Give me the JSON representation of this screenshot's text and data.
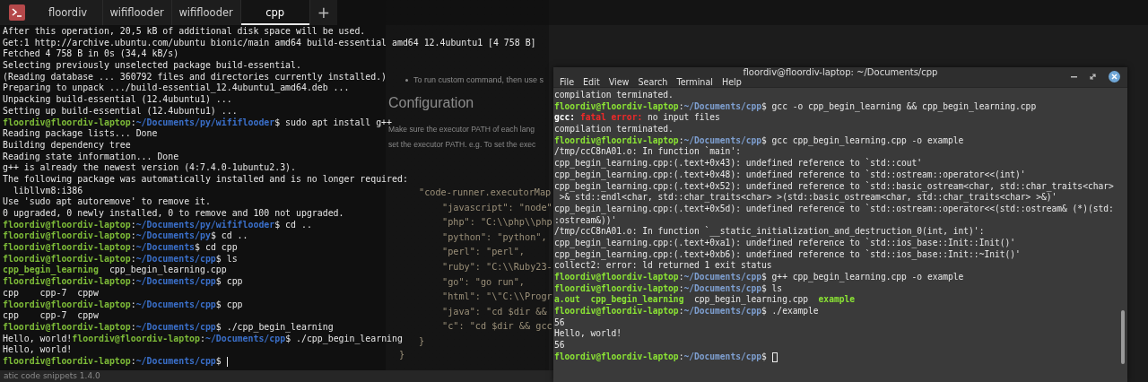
{
  "left_terminal": {
    "tabs": [
      {
        "label": "floordiv",
        "selected": false
      },
      {
        "label": "wififlooder",
        "selected": false
      },
      {
        "label": "wififlooder",
        "selected": false
      },
      {
        "label": "cpp",
        "selected": true
      }
    ],
    "new_tab": "+",
    "lines": [
      {
        "parts": [
          {
            "kind": "text",
            "text": "After this operation, 20,5 kB of additional disk space will be used."
          }
        ]
      },
      {
        "parts": [
          {
            "kind": "text",
            "text": "Get:1 http://archive.ubuntu.com/ubuntu bionic/main amd64 build-essential amd64 12.4ubuntu1 [4 758 B]"
          }
        ]
      },
      {
        "parts": [
          {
            "kind": "text",
            "text": "Fetched 4 758 B in 0s (34,4 kB/s)"
          }
        ]
      },
      {
        "parts": [
          {
            "kind": "text",
            "text": "Selecting previously unselected package build-essential."
          }
        ]
      },
      {
        "parts": [
          {
            "kind": "text",
            "text": "(Reading database ... 360792 files and directories currently installed.)"
          }
        ]
      },
      {
        "parts": [
          {
            "kind": "text",
            "text": "Preparing to unpack .../build-essential_12.4ubuntu1_amd64.deb ..."
          }
        ]
      },
      {
        "parts": [
          {
            "kind": "text",
            "text": "Unpacking build-essential (12.4ubuntu1) ..."
          }
        ]
      },
      {
        "parts": [
          {
            "kind": "text",
            "text": "Setting up build-essential (12.4ubuntu1) ..."
          }
        ]
      },
      {
        "parts": [
          {
            "kind": "user",
            "text": "floordiv@floordiv-laptop"
          },
          {
            "kind": "text",
            "text": ":"
          },
          {
            "kind": "path",
            "text": "~/Documents/py/wififlooder"
          },
          {
            "kind": "text",
            "text": "$ sudo apt install g++"
          }
        ]
      },
      {
        "parts": [
          {
            "kind": "text",
            "text": "Reading package lists... Done"
          }
        ]
      },
      {
        "parts": [
          {
            "kind": "text",
            "text": "Building dependency tree"
          }
        ]
      },
      {
        "parts": [
          {
            "kind": "text",
            "text": "Reading state information... Done"
          }
        ]
      },
      {
        "parts": [
          {
            "kind": "text",
            "text": "g++ is already the newest version (4:7.4.0-1ubuntu2.3)."
          }
        ]
      },
      {
        "parts": [
          {
            "kind": "text",
            "text": "The following package was automatically installed and is no longer required:"
          }
        ]
      },
      {
        "parts": [
          {
            "kind": "text",
            "text": "  libllvm8:i386"
          }
        ]
      },
      {
        "parts": [
          {
            "kind": "text",
            "text": "Use 'sudo apt autoremove' to remove it."
          }
        ]
      },
      {
        "parts": [
          {
            "kind": "text",
            "text": "0 upgraded, 0 newly installed, 0 to remove and 100 not upgraded."
          }
        ]
      },
      {
        "parts": [
          {
            "kind": "user",
            "text": "floordiv@floordiv-laptop"
          },
          {
            "kind": "text",
            "text": ":"
          },
          {
            "kind": "path",
            "text": "~/Documents/py/wififlooder"
          },
          {
            "kind": "text",
            "text": "$ cd .."
          }
        ]
      },
      {
        "parts": [
          {
            "kind": "user",
            "text": "floordiv@floordiv-laptop"
          },
          {
            "kind": "text",
            "text": ":"
          },
          {
            "kind": "path",
            "text": "~/Documents/py"
          },
          {
            "kind": "text",
            "text": "$ cd .."
          }
        ]
      },
      {
        "parts": [
          {
            "kind": "user",
            "text": "floordiv@floordiv-laptop"
          },
          {
            "kind": "text",
            "text": ":"
          },
          {
            "kind": "path",
            "text": "~/Documents"
          },
          {
            "kind": "text",
            "text": "$ cd cpp"
          }
        ]
      },
      {
        "parts": [
          {
            "kind": "user",
            "text": "floordiv@floordiv-laptop"
          },
          {
            "kind": "text",
            "text": ":"
          },
          {
            "kind": "path",
            "text": "~/Documents/cpp"
          },
          {
            "kind": "text",
            "text": "$ ls"
          }
        ]
      },
      {
        "parts": [
          {
            "kind": "exec",
            "text": "cpp_begin_learning"
          },
          {
            "kind": "text",
            "text": "  cpp_begin_learning.cpp"
          }
        ]
      },
      {
        "parts": [
          {
            "kind": "user",
            "text": "floordiv@floordiv-laptop"
          },
          {
            "kind": "text",
            "text": ":"
          },
          {
            "kind": "path",
            "text": "~/Documents/cpp"
          },
          {
            "kind": "text",
            "text": "$ cpp"
          }
        ]
      },
      {
        "parts": [
          {
            "kind": "text",
            "text": "cpp    cpp-7  cppw"
          }
        ]
      },
      {
        "parts": [
          {
            "kind": "user",
            "text": "floordiv@floordiv-laptop"
          },
          {
            "kind": "text",
            "text": ":"
          },
          {
            "kind": "path",
            "text": "~/Documents/cpp"
          },
          {
            "kind": "text",
            "text": "$ cpp"
          }
        ]
      },
      {
        "parts": [
          {
            "kind": "text",
            "text": "cpp    cpp-7  cppw"
          }
        ]
      },
      {
        "parts": [
          {
            "kind": "user",
            "text": "floordiv@floordiv-laptop"
          },
          {
            "kind": "text",
            "text": ":"
          },
          {
            "kind": "path",
            "text": "~/Documents/cpp"
          },
          {
            "kind": "text",
            "text": "$ ./cpp_begin_learning"
          }
        ]
      },
      {
        "parts": [
          {
            "kind": "text",
            "text": "Hello, world!"
          },
          {
            "kind": "user",
            "text": "floordiv@floordiv-laptop"
          },
          {
            "kind": "text",
            "text": ":"
          },
          {
            "kind": "path",
            "text": "~/Documents/cpp"
          },
          {
            "kind": "text",
            "text": "$ ./cpp_begin_learning"
          }
        ]
      },
      {
        "parts": [
          {
            "kind": "text",
            "text": "Hello, world!"
          }
        ]
      },
      {
        "parts": [
          {
            "kind": "user",
            "text": "floordiv@floordiv-laptop"
          },
          {
            "kind": "text",
            "text": ":"
          },
          {
            "kind": "path",
            "text": "~/Documents/cpp"
          },
          {
            "kind": "text",
            "text": "$ "
          }
        ],
        "cursor": true
      }
    ]
  },
  "background_page": {
    "bullet": "To run custom command, then use s",
    "heading": "Configuration",
    "paragraph_lines": [
      "Make sure the executor PATH of each lang",
      "set the executor PATH. e.g. To set the exec"
    ],
    "code": [
      {
        "text": "\"code-runner.executorMap",
        "children": [
          {
            "text": "\"javascript\": \"node\""
          },
          {
            "text": "\"php\": \"C:\\\\php\\\\php"
          },
          {
            "text": "\"python\": \"python\","
          },
          {
            "text": "\"perl\": \"perl\","
          },
          {
            "text": "\"ruby\": \"C:\\\\Ruby23-"
          },
          {
            "text": "\"go\": \"go run\","
          },
          {
            "text": "\"html\": \"\\\"C:\\\\Progr"
          },
          {
            "text": "\"java\": \"cd $dir &&"
          },
          {
            "text": "\"c\": \"cd $dir && gcc"
          }
        ]
      },
      {
        "text": "}"
      }
    ],
    "code_end": "}",
    "footer": "atic code snippets 1.4.0"
  },
  "right_terminal": {
    "title": "floordiv@floordiv-laptop: ~/Documents/cpp",
    "menu": [
      "File",
      "Edit",
      "View",
      "Search",
      "Terminal",
      "Help"
    ],
    "lines": [
      {
        "parts": [
          {
            "kind": "text",
            "text": "compilation terminated."
          }
        ]
      },
      {
        "parts": [
          {
            "kind": "user",
            "text": "floordiv@floordiv-laptop"
          },
          {
            "kind": "text",
            "text": ":"
          },
          {
            "kind": "path",
            "text": "~/Documents/cpp"
          },
          {
            "kind": "text",
            "text": "$ gcc -o cpp_begin_learning && cpp_begin_learning.cpp"
          }
        ]
      },
      {
        "parts": [
          {
            "kind": "bold",
            "text": "gcc: "
          },
          {
            "kind": "error",
            "text": "fatal error:"
          },
          {
            "kind": "text",
            "text": " no input files"
          }
        ]
      },
      {
        "parts": [
          {
            "kind": "text",
            "text": "compilation terminated."
          }
        ]
      },
      {
        "parts": [
          {
            "kind": "user",
            "text": "floordiv@floordiv-laptop"
          },
          {
            "kind": "text",
            "text": ":"
          },
          {
            "kind": "path",
            "text": "~/Documents/cpp"
          },
          {
            "kind": "text",
            "text": "$ gcc cpp_begin_learning.cpp -o example"
          }
        ]
      },
      {
        "parts": [
          {
            "kind": "text",
            "text": "/tmp/ccC8nA01.o: In function `main':"
          }
        ]
      },
      {
        "parts": [
          {
            "kind": "text",
            "text": "cpp_begin_learning.cpp:(.text+0x43): undefined reference to `std::cout'"
          }
        ]
      },
      {
        "parts": [
          {
            "kind": "text",
            "text": "cpp_begin_learning.cpp:(.text+0x48): undefined reference to `std::ostream::operator<<(int)'"
          }
        ]
      },
      {
        "parts": [
          {
            "kind": "text",
            "text": "cpp_begin_learning.cpp:(.text+0x52): undefined reference to `std::basic_ostream<char, std::char_traits<char>"
          }
        ]
      },
      {
        "parts": [
          {
            "kind": "text",
            "text": " >& std::endl<char, std::char_traits<char> >(std::basic_ostream<char, std::char_traits<char> >&)'"
          }
        ]
      },
      {
        "parts": [
          {
            "kind": "text",
            "text": "cpp_begin_learning.cpp:(.text+0x5d): undefined reference to `std::ostream::operator<<(std::ostream& (*)(std:"
          }
        ]
      },
      {
        "parts": [
          {
            "kind": "text",
            "text": ":ostream&))'"
          }
        ]
      },
      {
        "parts": [
          {
            "kind": "text",
            "text": "/tmp/ccC8nA01.o: In function `__static_initialization_and_destruction_0(int, int)':"
          }
        ]
      },
      {
        "parts": [
          {
            "kind": "text",
            "text": "cpp_begin_learning.cpp:(.text+0xa1): undefined reference to `std::ios_base::Init::Init()'"
          }
        ]
      },
      {
        "parts": [
          {
            "kind": "text",
            "text": "cpp_begin_learning.cpp:(.text+0xb6): undefined reference to `std::ios_base::Init::~Init()'"
          }
        ]
      },
      {
        "parts": [
          {
            "kind": "text",
            "text": "collect2: error: ld returned 1 exit status"
          }
        ]
      },
      {
        "parts": [
          {
            "kind": "user",
            "text": "floordiv@floordiv-laptop"
          },
          {
            "kind": "text",
            "text": ":"
          },
          {
            "kind": "path",
            "text": "~/Documents/cpp"
          },
          {
            "kind": "text",
            "text": "$ g++ cpp_begin_learning.cpp -o example"
          }
        ]
      },
      {
        "parts": [
          {
            "kind": "user",
            "text": "floordiv@floordiv-laptop"
          },
          {
            "kind": "text",
            "text": ":"
          },
          {
            "kind": "path",
            "text": "~/Documents/cpp"
          },
          {
            "kind": "text",
            "text": "$ ls"
          }
        ]
      },
      {
        "parts": [
          {
            "kind": "exec",
            "text": "a.out  "
          },
          {
            "kind": "exec",
            "text": "cpp_begin_learning"
          },
          {
            "kind": "text",
            "text": "  cpp_begin_learning.cpp  "
          },
          {
            "kind": "exec",
            "text": "example"
          }
        ]
      },
      {
        "parts": [
          {
            "kind": "user",
            "text": "floordiv@floordiv-laptop"
          },
          {
            "kind": "text",
            "text": ":"
          },
          {
            "kind": "path",
            "text": "~/Documents/cpp"
          },
          {
            "kind": "text",
            "text": "$ ./example"
          }
        ]
      },
      {
        "parts": [
          {
            "kind": "text",
            "text": "56"
          }
        ]
      },
      {
        "parts": [
          {
            "kind": "text",
            "text": "Hello, world!"
          }
        ]
      },
      {
        "parts": [
          {
            "kind": "text",
            "text": "56"
          }
        ]
      },
      {
        "parts": [
          {
            "kind": "user",
            "text": "floordiv@floordiv-laptop"
          },
          {
            "kind": "text",
            "text": ":"
          },
          {
            "kind": "path",
            "text": "~/Documents/cpp"
          },
          {
            "kind": "text",
            "text": "$ "
          }
        ],
        "cursor": true
      }
    ]
  }
}
